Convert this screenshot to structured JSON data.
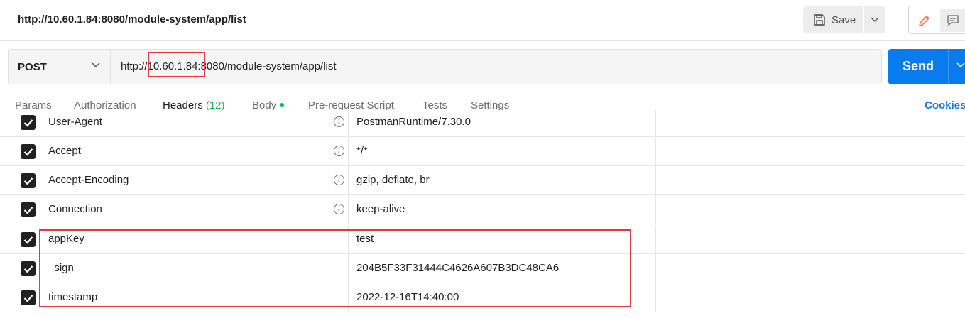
{
  "tab_title": "http://10.60.1.84:8080/module-system/app/list",
  "toolbar": {
    "save_label": "Save"
  },
  "request": {
    "method": "POST",
    "url": "http://10.60.1.84:8080/module-system/app/list",
    "send_label": "Send"
  },
  "tabs": [
    {
      "label": "Params"
    },
    {
      "label": "Authorization"
    },
    {
      "label": "Headers",
      "count": "(12)",
      "active": true
    },
    {
      "label": "Body"
    },
    {
      "label": "Pre-request Script"
    },
    {
      "label": "Tests"
    },
    {
      "label": "Settings"
    }
  ],
  "cookies_label": "Cookies",
  "headers": [
    {
      "key": "User-Agent",
      "value": "PostmanRuntime/7.30.0",
      "checked": true,
      "auto": true
    },
    {
      "key": "Accept",
      "value": "*/*",
      "checked": true,
      "auto": true
    },
    {
      "key": "Accept-Encoding",
      "value": "gzip, deflate, br",
      "checked": true,
      "auto": true
    },
    {
      "key": "Connection",
      "value": "keep-alive",
      "checked": true,
      "auto": true
    },
    {
      "key": "appKey",
      "value": "test",
      "checked": true,
      "auto": false
    },
    {
      "key": "_sign",
      "value": "204B5F33F31444C4626A607B3DC48CA6",
      "checked": true,
      "auto": false
    },
    {
      "key": "timestamp",
      "value": "2022-12-16T14:40:00",
      "checked": true,
      "auto": false
    }
  ],
  "colors": {
    "accent": "#ff6c37",
    "send": "#097bed",
    "highlight": "#e0393e",
    "dot": "#0cbb52"
  }
}
